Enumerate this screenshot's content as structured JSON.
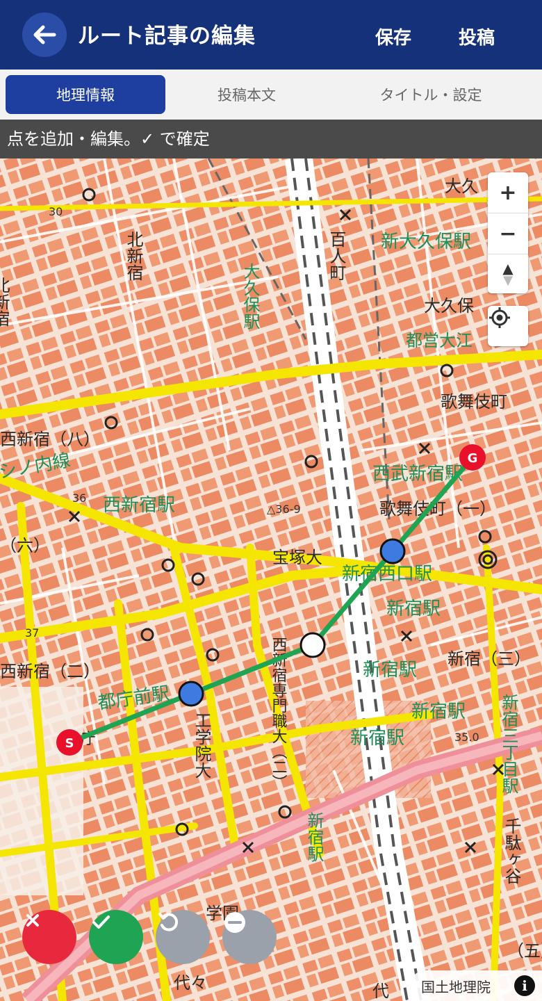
{
  "header": {
    "title": "ルート記事の編集",
    "save_label": "保存",
    "post_label": "投稿"
  },
  "tabs": [
    {
      "label": "地理情報",
      "active": true
    },
    {
      "label": "投稿本文",
      "active": false
    },
    {
      "label": "タイトル・設定",
      "active": false
    }
  ],
  "hint": {
    "text": "点を追加・編集。✓ で確定"
  },
  "map": {
    "labels": {
      "nishishinjuku8": "西新宿（八）",
      "nishishinjuku_sta": "西新宿駅",
      "roku": "（六）",
      "nishishinjuku2": "西新宿（二）",
      "tochomae_sta": "都庁前駅",
      "seibu_shinjuku": "西武新宿駅",
      "kabukicho": "歌舞伎町",
      "kabukicho1": "歌舞伎町（一）",
      "takarazuka": "宝塚大",
      "shinjuku_nishiguchi": "新宿西口駅",
      "shinjuku_sta_a": "新宿駅",
      "shinjuku_sta_b": "新宿駅",
      "shinjuku_sta_c": "新宿駅",
      "shinjuku_sta_d": "新宿駅",
      "shinjuku3": "新宿（三）",
      "toei_oedo": "都営大江",
      "okubo": "大久保",
      "okubo_top": "大久",
      "shin_okubo": "新大久保駅",
      "okubo_sta": "大久保駅",
      "hyakunincho": "百人町",
      "kitashinjuku": "北新宿",
      "kita_left": "北新宿",
      "kogakuin": "工学院大",
      "senmon": "西新宿専門職大（二）",
      "shinjuku_v": "新宿駅",
      "shinjuku3chome": "新宿三丁目駅",
      "sendagaya": "千駄ヶ谷",
      "go": "（五）",
      "gakuen": "学園",
      "yoyogi": "代々",
      "dai": "代",
      "fushin": "シノ内線",
      "elev_36": "36",
      "elev_36_9": "△36-9",
      "elev_37": "37",
      "elev_30": "30",
      "elev_35": "35.0",
      "cho": "庁"
    },
    "route": {
      "start_label": "S",
      "goal_label": "G",
      "color": "#1fa453"
    },
    "attribution": "国土地理院",
    "info_glyph": "i"
  },
  "controls": {
    "zoom_in": "+",
    "zoom_out": "−",
    "compass": "▲",
    "locate_icon": "locate-icon"
  },
  "actions": {
    "cancel": "cancel",
    "confirm": "confirm",
    "undo": "undo",
    "remove": "remove"
  },
  "colors": {
    "header": "#14317a",
    "tab_active": "#1e3fa0",
    "cancel": "#e8283c",
    "confirm": "#1ea453",
    "neutral": "#9ba1ab"
  }
}
